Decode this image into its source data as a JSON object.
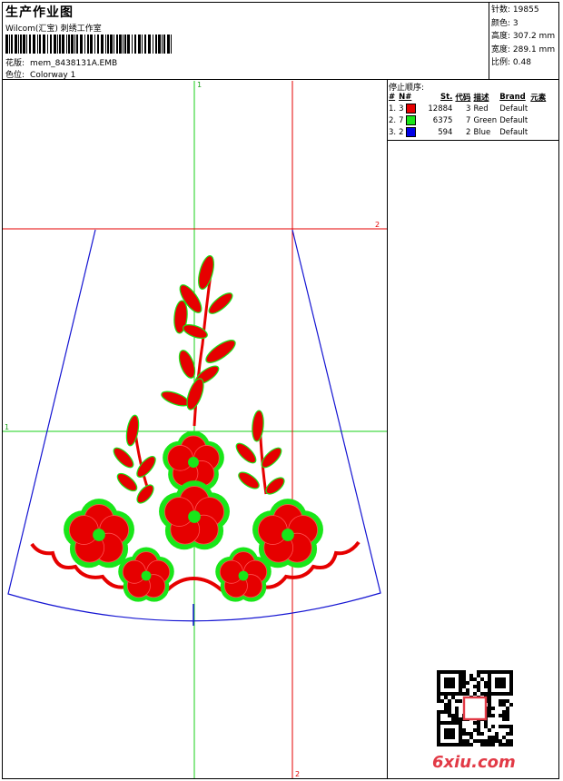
{
  "header": {
    "title": "生产作业图",
    "subtitle": "Wilcom(汇宝) 刺绣工作室",
    "design_label": "花版:",
    "design_value": "mem_8438131A.EMB",
    "colorway_label": "色位:",
    "colorway_value": "Colorway 1"
  },
  "stats": {
    "stitches_label": "针数:",
    "stitches_value": "19855",
    "colors_label": "颜色:",
    "colors_value": "3",
    "height_label": "高度:",
    "height_value": "307.2 mm",
    "width_label": "宽度:",
    "width_value": "289.1 mm",
    "scale_label": "比例:",
    "scale_value": "0.48"
  },
  "stop_sequence": {
    "title": "停止顺序:",
    "headers": [
      "#",
      "N#",
      "St.",
      "代码",
      "描述",
      "Brand",
      "元素"
    ],
    "rows": [
      {
        "idx": "1.",
        "n": "3",
        "color": "#e60000",
        "stitches": "12884",
        "code": "3",
        "desc": "Red",
        "brand": "Default"
      },
      {
        "idx": "2.",
        "n": "7",
        "color": "#19e619",
        "stitches": "6375",
        "code": "7",
        "desc": "Green",
        "brand": "Default"
      },
      {
        "idx": "3.",
        "n": "2",
        "color": "#0000e6",
        "stitches": "594",
        "code": "2",
        "desc": "Blue",
        "brand": "Default"
      }
    ]
  },
  "guides": {
    "v1": "1",
    "h1": "1",
    "v2": "2",
    "h2": "2"
  },
  "watermark": "6xiu.com"
}
